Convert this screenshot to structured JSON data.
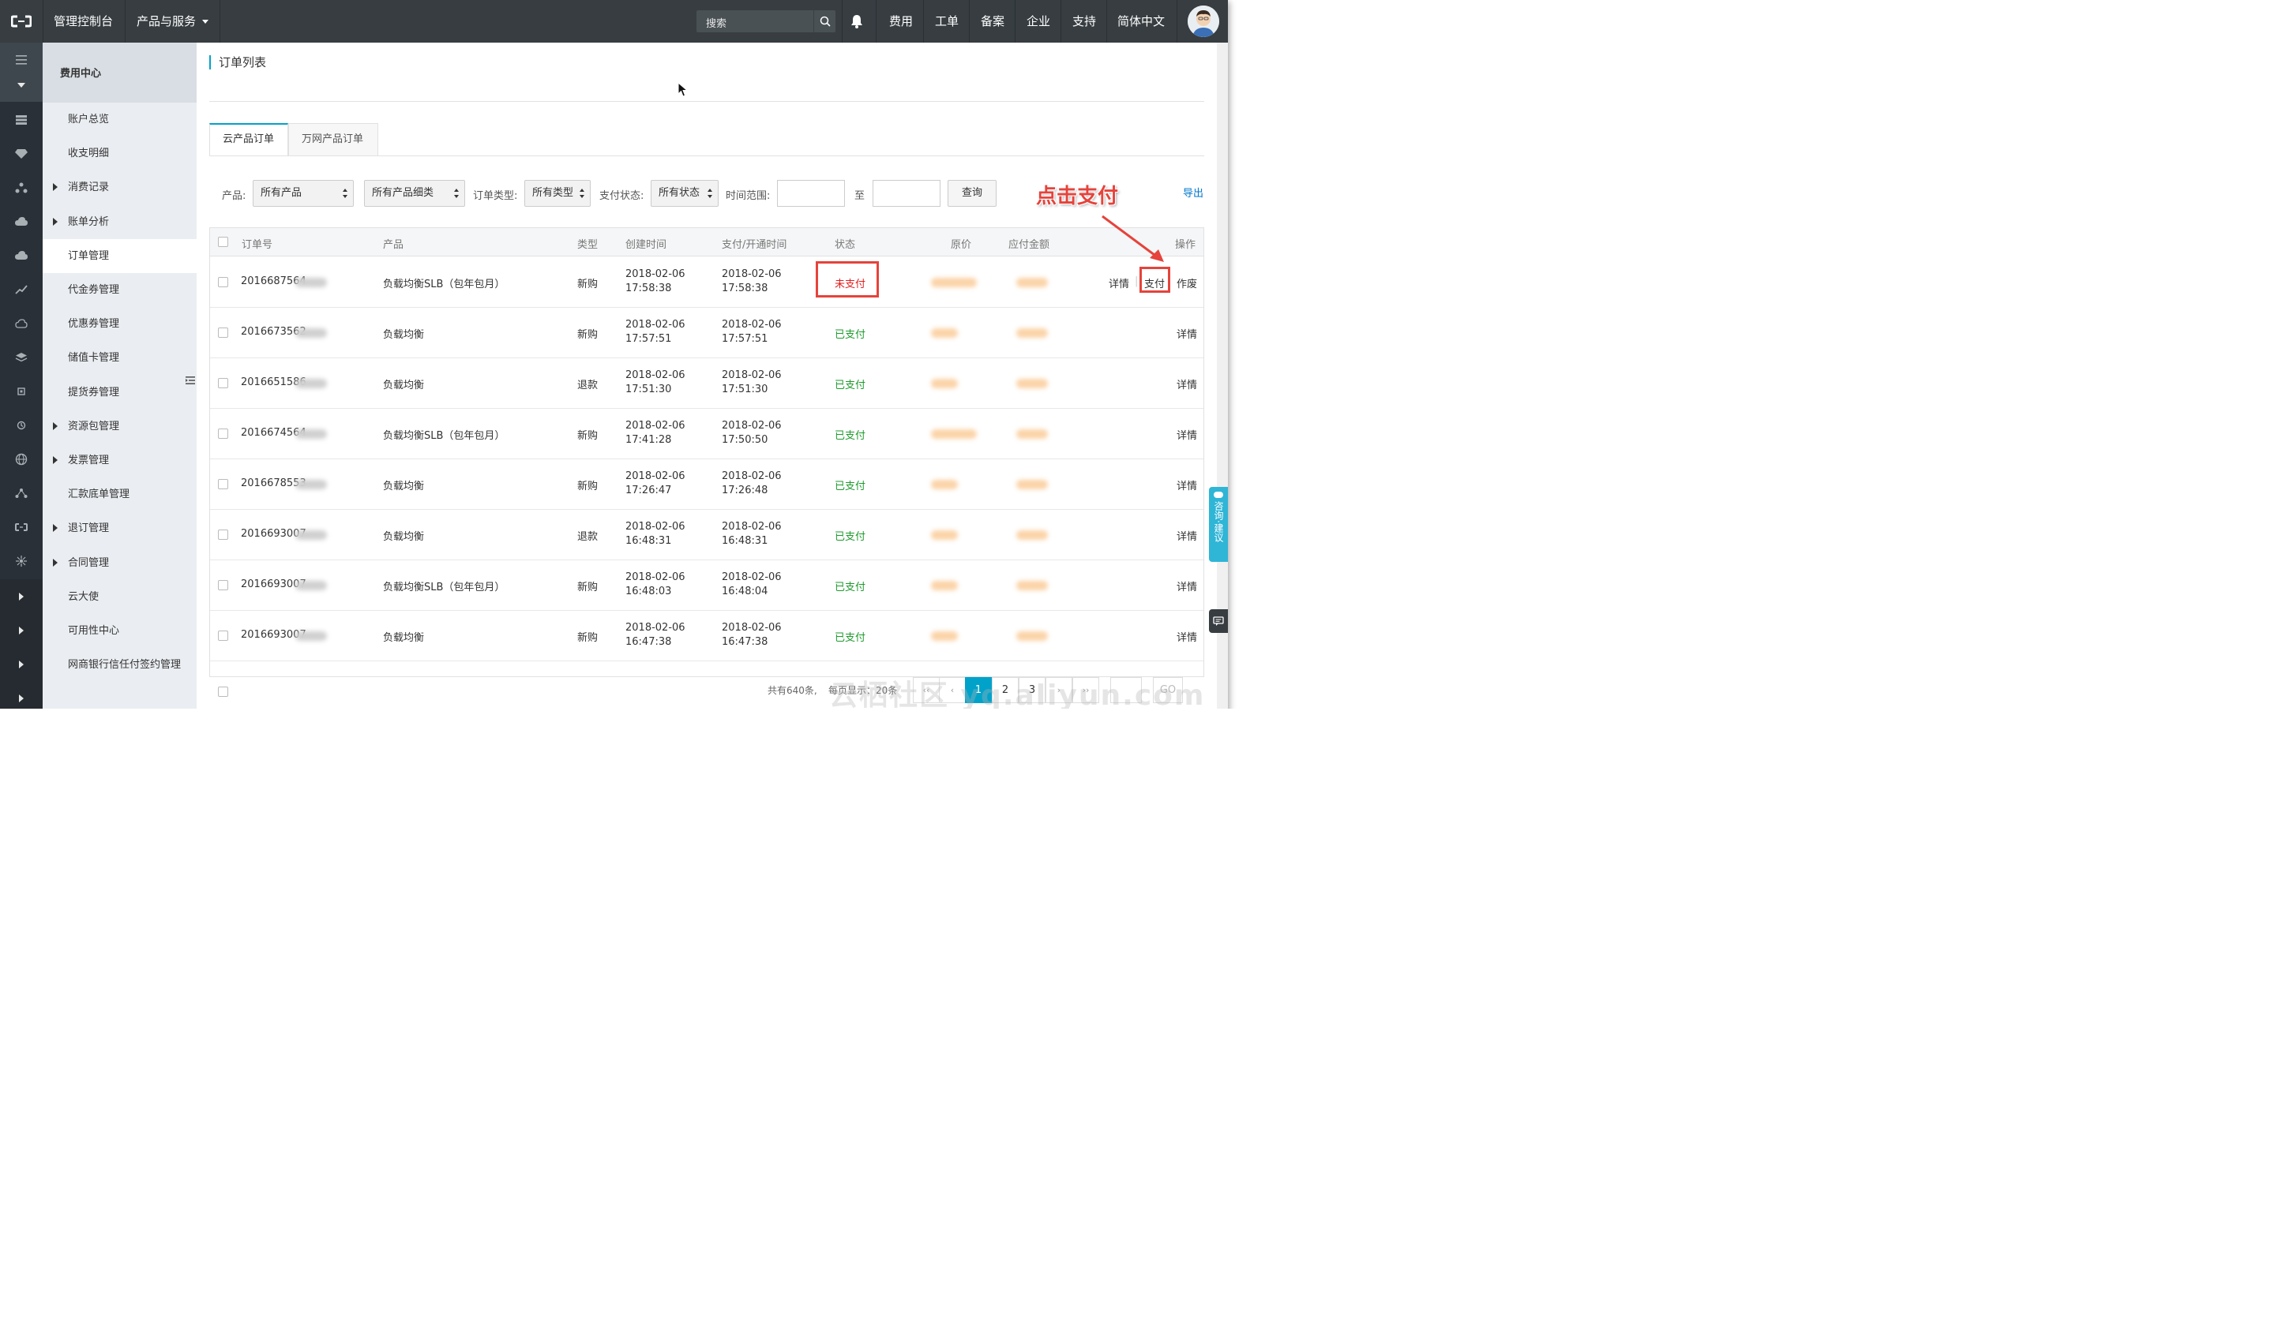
{
  "topbar": {
    "console": "管理控制台",
    "products": "产品与服务",
    "search_placeholder": "搜索",
    "links": [
      "费用",
      "工单",
      "备案",
      "企业",
      "支持",
      "简体中文"
    ]
  },
  "sidebar": {
    "title": "费用中心",
    "items": [
      {
        "label": "账户总览",
        "arrow": false
      },
      {
        "label": "收支明细",
        "arrow": false
      },
      {
        "label": "消费记录",
        "arrow": true
      },
      {
        "label": "账单分析",
        "arrow": true
      },
      {
        "label": "订单管理",
        "arrow": false,
        "active": true
      },
      {
        "label": "代金券管理",
        "arrow": false
      },
      {
        "label": "优惠券管理",
        "arrow": false
      },
      {
        "label": "储值卡管理",
        "arrow": false
      },
      {
        "label": "提货券管理",
        "arrow": false
      },
      {
        "label": "资源包管理",
        "arrow": true
      },
      {
        "label": "发票管理",
        "arrow": true
      },
      {
        "label": "汇款底单管理",
        "arrow": false
      },
      {
        "label": "退订管理",
        "arrow": true
      },
      {
        "label": "合同管理",
        "arrow": true
      },
      {
        "label": "云大使",
        "arrow": false
      },
      {
        "label": "可用性中心",
        "arrow": false
      },
      {
        "label": "网商银行信任付签约管理",
        "arrow": false
      }
    ]
  },
  "main": {
    "title": "订单列表",
    "tabs": [
      "云产品订单",
      "万网产品订单"
    ],
    "filters": {
      "product_label": "产品:",
      "product_value": "所有产品",
      "subproduct_value": "所有产品细类",
      "type_label": "订单类型:",
      "type_value": "所有类型",
      "pay_label": "支付状态:",
      "pay_value": "所有状态",
      "time_label": "时间范围:",
      "to_label": "至",
      "query_label": "查询",
      "export_label": "导出"
    },
    "annotation": "点击支付",
    "table": {
      "headers": [
        "订单号",
        "产品",
        "类型",
        "创建时间",
        "支付/开通时间",
        "状态",
        "原价",
        "应付金额",
        "操作"
      ],
      "rows": [
        {
          "id": "201668756​4",
          "product": "负载均衡SLB（包年包月）",
          "type": "新购",
          "created_date": "2018-02-06",
          "created_time": "17:58:38",
          "paid_date": "2018-02-06",
          "paid_time": "17:58:38",
          "status": "未支付",
          "unpaid": true
        },
        {
          "id": "2016673562",
          "product": "负载均衡",
          "type": "新购",
          "created_date": "2018-02-06",
          "created_time": "17:57:51",
          "paid_date": "2018-02-06",
          "paid_time": "17:57:51",
          "status": "已支付"
        },
        {
          "id": "2016651586",
          "product": "负载均衡",
          "type": "退款",
          "created_date": "2018-02-06",
          "created_time": "17:51:30",
          "paid_date": "2018-02-06",
          "paid_time": "17:51:30",
          "status": "已支付"
        },
        {
          "id": "2016674564",
          "product": "负载均衡SLB（包年包月）",
          "type": "新购",
          "created_date": "2018-02-06",
          "created_time": "17:41:28",
          "paid_date": "2018-02-06",
          "paid_time": "17:50:50",
          "status": "已支付"
        },
        {
          "id": "2016678553",
          "product": "负载均衡",
          "type": "新购",
          "created_date": "2018-02-06",
          "created_time": "17:26:47",
          "paid_date": "2018-02-06",
          "paid_time": "17:26:48",
          "status": "已支付"
        },
        {
          "id": "2016693007",
          "product": "负载均衡",
          "type": "退款",
          "created_date": "2018-02-06",
          "created_time": "16:48:31",
          "paid_date": "2018-02-06",
          "paid_time": "16:48:31",
          "status": "已支付"
        },
        {
          "id": "2016693007",
          "product": "负载均衡SLB（包年包月）",
          "type": "新购",
          "created_date": "2018-02-06",
          "created_time": "16:48:03",
          "paid_date": "2018-02-06",
          "paid_time": "16:48:04",
          "status": "已支付"
        },
        {
          "id": "2016693007",
          "product": "负载均衡",
          "type": "新购",
          "created_date": "2018-02-06",
          "created_time": "16:47:38",
          "paid_date": "2018-02-06",
          "paid_time": "16:47:38",
          "status": "已支付"
        }
      ],
      "actions": {
        "detail": "详情",
        "pay": "支付",
        "cancel": "作废"
      }
    },
    "footer": {
      "total": "共有640条,",
      "per_page": "每页显示：20条",
      "pages": [
        "‹‹",
        "‹",
        "1",
        "2",
        "3",
        "›",
        "››"
      ],
      "go": "GO"
    }
  },
  "feedback": "咨询·建议",
  "watermark": "云栖社区 yq.aliyun.com",
  "colors": {
    "accent": "#00a2ca",
    "topbar": "#373d41",
    "paid": "#1e9a2d",
    "unpaid": "#e02020",
    "annotation": "#e5433b"
  }
}
